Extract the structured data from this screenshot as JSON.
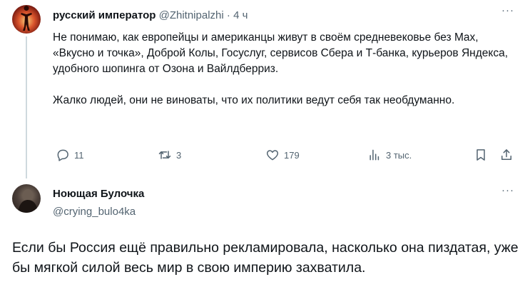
{
  "tweet1": {
    "display_name": "русский император",
    "handle": "@Zhitnipalzhi",
    "separator": "·",
    "time": "4 ч",
    "more": "···",
    "text_p1": "Не понимаю, как европейцы и американцы живут в своём средневековье без Max, «Вкусно и точка», Доброй Колы, Госуслуг, сервисов Сбера и Т-банка, курьеров Яндекса, удобного шопинга от Озона и Вайлдберриз.",
    "text_p2": "Жалко людей, они не виноваты, что их политики ведут себя так необдуманно.",
    "actions": {
      "replies": "11",
      "reposts": "3",
      "likes": "179",
      "views": "3 тыс."
    },
    "icons": {
      "reply": "reply-icon",
      "repost": "repost-icon",
      "like": "heart-icon",
      "views": "analytics-icon",
      "bookmark": "bookmark-icon",
      "share": "share-icon"
    }
  },
  "tweet2": {
    "display_name": "Ноющая Булочка",
    "handle": "@crying_bulo4ka",
    "more": "···",
    "text": "Если бы Россия ещё правильно рекламировала, насколько она пиздатая, уже бы мягкой силой весь мир в свою империю захватила."
  },
  "colors": {
    "text_primary": "#0f1419",
    "text_secondary": "#536471",
    "thread_line": "#cfd9de"
  }
}
